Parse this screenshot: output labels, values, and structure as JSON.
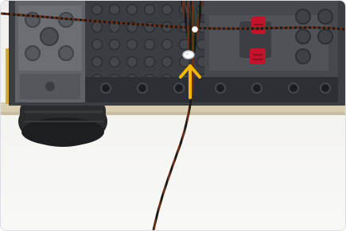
{
  "photo": {
    "subject": "lego-model-with-cable-and-highlight-arrow",
    "colors": {
      "background": "#f3f2ee",
      "brick_dark": "#3a3d42",
      "brick_mid": "#5b5e63",
      "brick_light": "#7a7d82",
      "red": "#c2142a",
      "tan": "#d9cdb2",
      "wire_brown": "#5a2a16",
      "wire_black": "#1a1a1a",
      "arrow": "#f5b800",
      "led": "#ffffff"
    }
  }
}
